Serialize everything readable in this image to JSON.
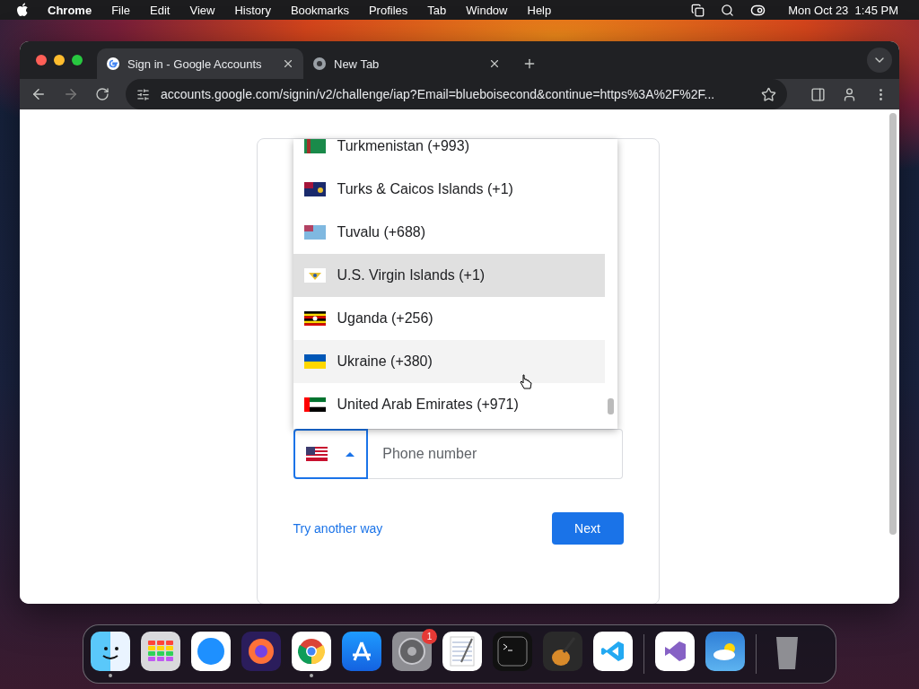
{
  "menu_bar": {
    "app": "Chrome",
    "items": [
      "File",
      "Edit",
      "View",
      "History",
      "Bookmarks",
      "Profiles",
      "Tab",
      "Window",
      "Help"
    ],
    "clock": "Mon Oct 23  1:45 PM"
  },
  "tabs": [
    {
      "label": "Sign in - Google Accounts",
      "selected": true
    },
    {
      "label": "New Tab",
      "selected": false
    }
  ],
  "address_bar": {
    "url": "accounts.google.com/signin/v2/challenge/iap?Email=blueboisecond&continue=https%3A%2F%2F..."
  },
  "country_list": [
    {
      "label": "Turkmenistan (+993)",
      "selected": false,
      "hovered": false
    },
    {
      "label": "Turks & Caicos Islands (+1)",
      "selected": false,
      "hovered": false
    },
    {
      "label": "Tuvalu (+688)",
      "selected": false,
      "hovered": false
    },
    {
      "label": "U.S. Virgin Islands (+1)",
      "selected": true,
      "hovered": false
    },
    {
      "label": "Uganda (+256)",
      "selected": false,
      "hovered": false
    },
    {
      "label": "Ukraine (+380)",
      "selected": false,
      "hovered": true
    },
    {
      "label": "United Arab Emirates (+971)",
      "selected": false,
      "hovered": false
    }
  ],
  "phone_field": {
    "placeholder": "Phone number"
  },
  "try_another_way": "Try another way",
  "next_button": "Next",
  "dock": [
    {
      "running": true
    },
    {
      "running": false
    },
    {
      "running": false
    },
    {
      "running": false
    },
    {
      "running": true
    },
    {
      "running": false
    },
    {
      "running": false,
      "badge": "1"
    },
    {
      "running": false
    },
    {
      "running": false
    },
    {
      "running": false
    },
    {
      "running": false
    },
    {
      "running": false
    },
    {
      "running": false
    },
    {
      "running": false
    }
  ]
}
